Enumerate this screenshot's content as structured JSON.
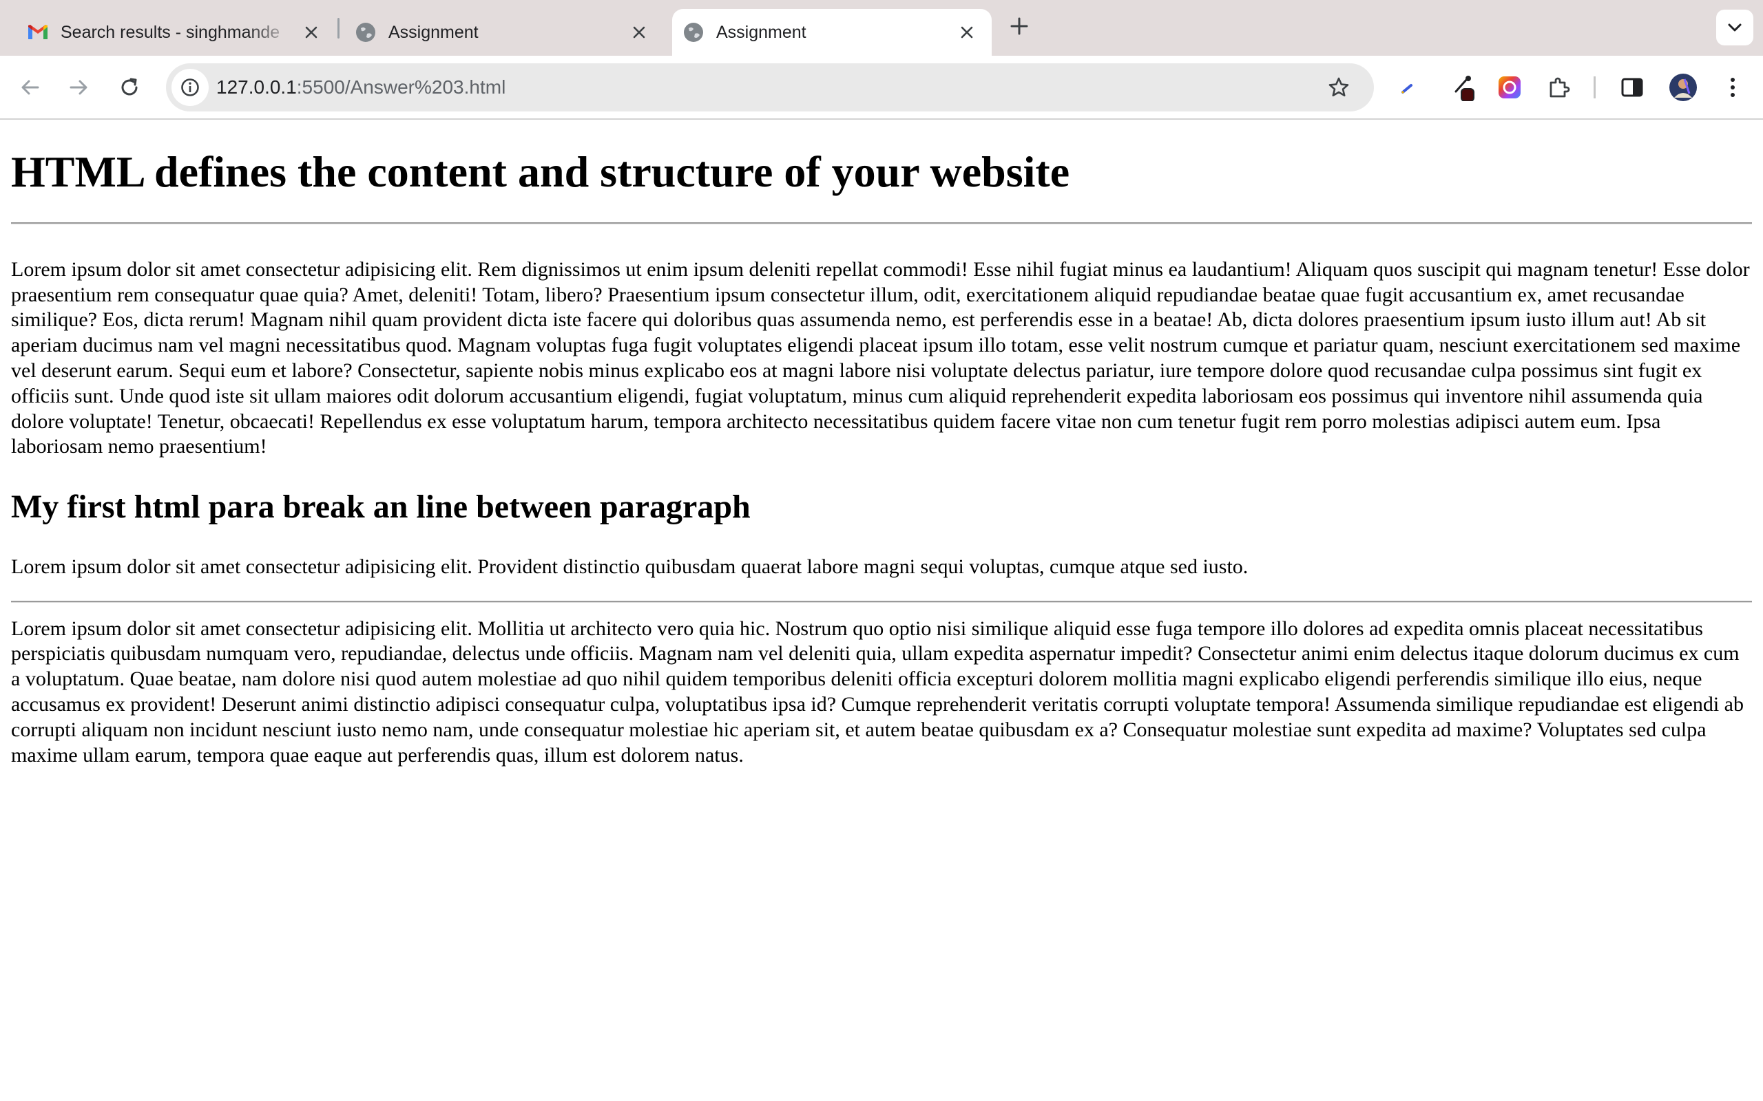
{
  "browser": {
    "tabs": [
      {
        "title": "Search results - singhmande",
        "icon": "gmail-icon",
        "active": false
      },
      {
        "title": "Assignment",
        "icon": "globe-icon",
        "active": false
      },
      {
        "title": "Assignment",
        "icon": "globe-icon",
        "active": true
      }
    ],
    "address_bar": {
      "host": "127.0.0.1",
      "path": ":5500/Answer%203.html"
    },
    "toolbar_icons": [
      "back-icon",
      "forward-icon",
      "reload-icon",
      "site-info-icon",
      "bookmark-star-icon",
      "extension-pen-icon",
      "extension-eyedropper-icon",
      "extension-color-icon",
      "extensions-puzzle-icon",
      "side-panel-icon",
      "profile-avatar",
      "menu-icon"
    ],
    "colors": {
      "tabstrip": "#e3dcdc",
      "omnibox": "#e9e9e9",
      "active_tab": "#ffffff"
    }
  },
  "page": {
    "heading1": "HTML defines the content and structure of your website",
    "paragraph1": "Lorem ipsum dolor sit amet consectetur adipisicing elit. Rem dignissimos ut enim ipsum deleniti repellat commodi! Esse nihil fugiat minus ea laudantium! Aliquam quos suscipit qui magnam tenetur! Esse dolor praesentium rem consequatur quae quia? Amet, deleniti! Totam, libero? Praesentium ipsum consectetur illum, odit, exercitationem aliquid repudiandae beatae quae fugit accusantium ex, amet recusandae similique? Eos, dicta rerum! Magnam nihil quam provident dicta iste facere qui doloribus quas assumenda nemo, est perferendis esse in a beatae! Ab, dicta dolores praesentium ipsum iusto illum aut! Ab sit aperiam ducimus nam vel magni necessitatibus quod. Magnam voluptas fuga fugit voluptates eligendi placeat ipsum illo totam, esse velit nostrum cumque et pariatur quam, nesciunt exercitationem sed maxime vel deserunt earum. Sequi eum et labore? Consectetur, sapiente nobis minus explicabo eos at magni labore nisi voluptate delectus pariatur, iure tempore dolore quod recusandae culpa possimus sint fugit ex officiis sunt. Unde quod iste sit ullam maiores odit dolorum accusantium eligendi, fugiat voluptatum, minus cum aliquid reprehenderit expedita laboriosam eos possimus qui inventore nihil assumenda quia dolore voluptate! Tenetur, obcaecati! Repellendus ex esse voluptatum harum, tempora architecto necessitatibus quidem facere vitae non cum tenetur fugit rem porro molestias adipisci autem eum. Ipsa laboriosam nemo praesentium!",
    "heading2": "My first html para break an line between paragraph",
    "paragraph2": "Lorem ipsum dolor sit amet consectetur adipisicing elit. Provident distinctio quibusdam quaerat labore magni sequi voluptas, cumque atque sed iusto.",
    "paragraph3": "Lorem ipsum dolor sit amet consectetur adipisicing elit. Mollitia ut architecto vero quia hic. Nostrum quo optio nisi similique aliquid esse fuga tempore illo dolores ad expedita omnis placeat necessitatibus perspiciatis quibusdam numquam vero, repudiandae, delectus unde officiis. Magnam nam vel deleniti quia, ullam expedita aspernatur impedit? Consectetur animi enim delectus itaque dolorum ducimus ex cum a voluptatum. Quae beatae, nam dolore nisi quod autem molestiae ad quo nihil quidem temporibus deleniti officia excepturi dolorem mollitia magni explicabo eligendi perferendis similique illo eius, neque accusamus ex provident! Deserunt animi distinctio adipisci consequatur culpa, voluptatibus ipsa id? Cumque reprehenderit veritatis corrupti voluptate tempora! Assumenda similique repudiandae est eligendi ab corrupti aliquam non incidunt nesciunt iusto nemo nam, unde consequatur molestiae hic aperiam sit, et autem beatae quibusdam ex a? Consequatur molestiae sunt expedita ad maxime? Voluptates sed culpa maxime ullam earum, tempora quae eaque aut perferendis quas, illum est dolorem natus."
  }
}
